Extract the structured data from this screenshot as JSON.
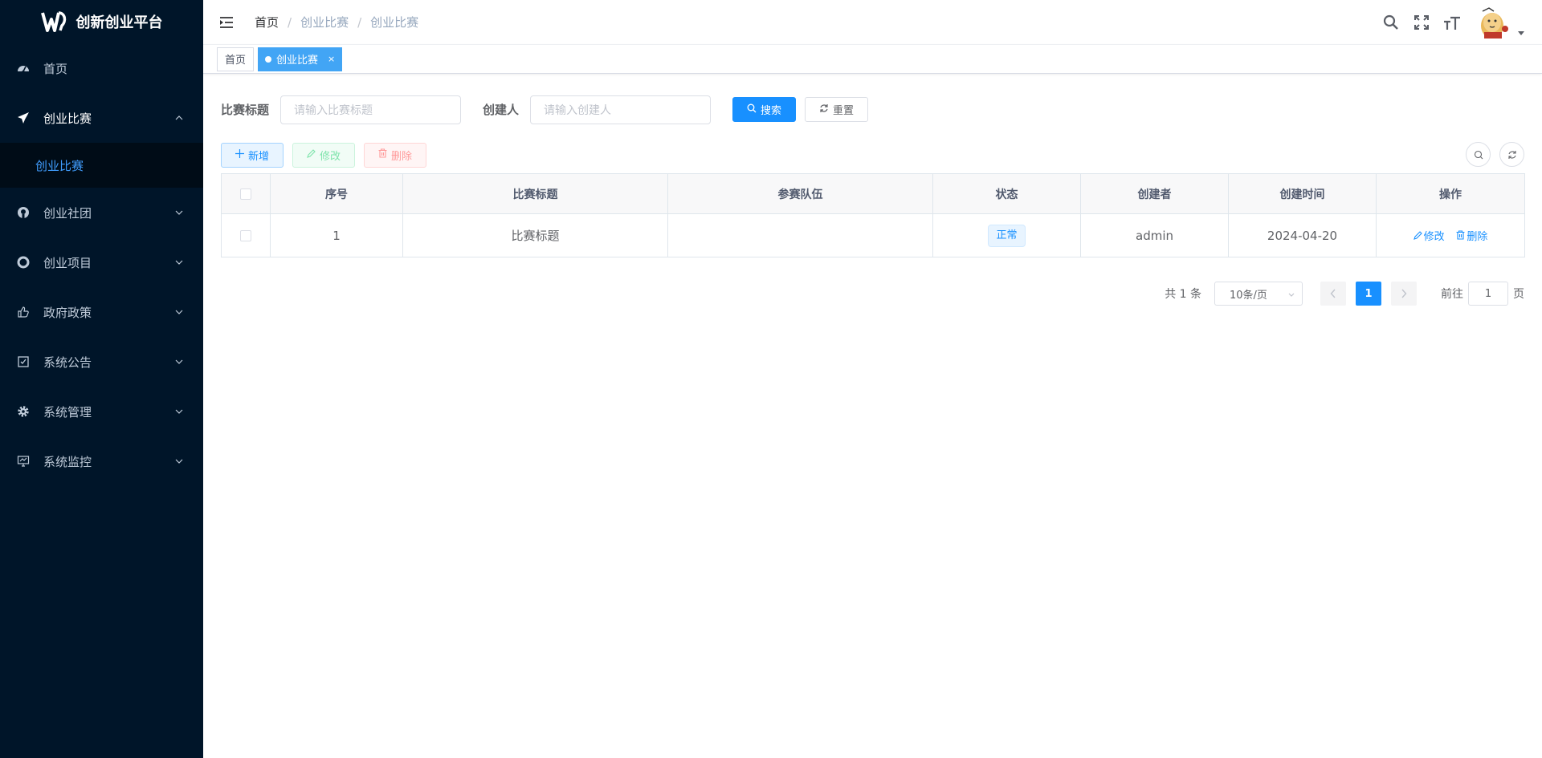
{
  "app": {
    "title": "创新创业平台"
  },
  "sidebar": {
    "items": [
      {
        "label": "首页",
        "icon": "dashboard-icon"
      },
      {
        "label": "创业比赛",
        "icon": "paper-plane-icon",
        "open": true,
        "children": [
          {
            "label": "创业比赛",
            "active": true
          }
        ]
      },
      {
        "label": "创业社团",
        "icon": "github-icon"
      },
      {
        "label": "创业项目",
        "icon": "lifebuoy-icon"
      },
      {
        "label": "政府政策",
        "icon": "thumb-icon"
      },
      {
        "label": "系统公告",
        "icon": "checkbox-icon"
      },
      {
        "label": "系统管理",
        "icon": "gear-icon"
      },
      {
        "label": "系统监控",
        "icon": "monitor-icon"
      }
    ]
  },
  "header": {
    "breadcrumb": [
      "首页",
      "创业比赛",
      "创业比赛"
    ],
    "breadcrumb_separator": "/"
  },
  "tags": [
    {
      "label": "首页",
      "active": false
    },
    {
      "label": "创业比赛",
      "active": true,
      "close": "×"
    }
  ],
  "search": {
    "title_label": "比赛标题",
    "title_placeholder": "请输入比赛标题",
    "creator_label": "创建人",
    "creator_placeholder": "请输入创建人",
    "search_button": "搜索",
    "reset_button": "重置"
  },
  "toolbar": {
    "add_label": "新增",
    "edit_label": "修改",
    "delete_label": "删除"
  },
  "table": {
    "columns": [
      "序号",
      "比赛标题",
      "参赛队伍",
      "状态",
      "创建者",
      "创建时间",
      "操作"
    ],
    "rows": [
      {
        "index": "1",
        "title": "比赛标题",
        "team": "",
        "status": "正常",
        "creator": "admin",
        "created": "2024-04-20",
        "edit": "修改",
        "delete": "删除"
      }
    ]
  },
  "pagination": {
    "total": "共 1 条",
    "page_size": "10条/页",
    "current_page": "1",
    "goto_prefix": "前往",
    "goto_value": "1",
    "goto_suffix": "页"
  },
  "colors": {
    "sidebar_bg": "#001529",
    "primary": "#1890ff",
    "active_tag": "#42a5f5"
  }
}
